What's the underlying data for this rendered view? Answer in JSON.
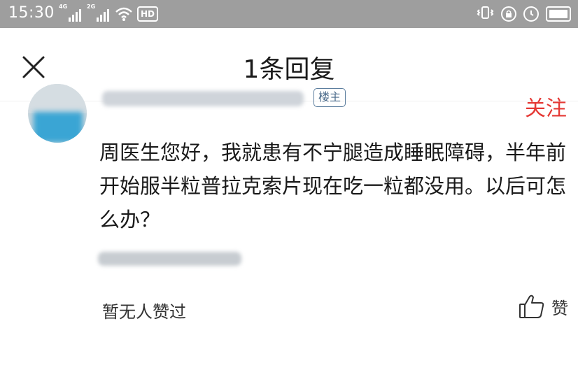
{
  "status_bar": {
    "time": "15:30",
    "signal1_label": "4G",
    "signal2_label": "2G",
    "hd_label": "HD"
  },
  "header": {
    "title": "1条回复"
  },
  "comment": {
    "op_badge": "楼主",
    "follow_label": "关注",
    "text": "周医生您好，我就患有不宁腿造成睡眠障碍，半年前开始服半粒普拉克索片现在吃一粒都没用。以后可怎么办？",
    "likes_status": "暂无人赞过",
    "like_label": "赞"
  }
}
